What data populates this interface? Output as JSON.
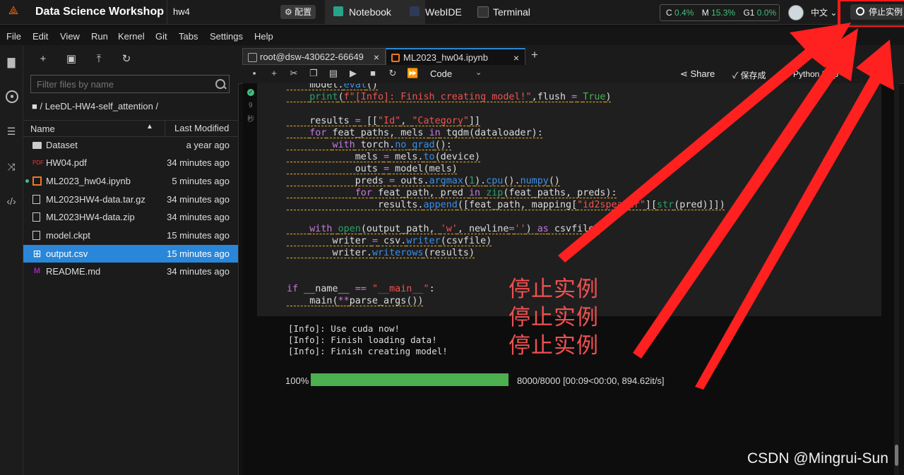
{
  "topbar": {
    "brand": "Data Science Workshop",
    "project": "hw4",
    "config_label": "⚙ 配置",
    "tabs": [
      {
        "label": "Notebook"
      },
      {
        "label": "WebIDE"
      },
      {
        "label": "Terminal"
      }
    ],
    "metrics": {
      "c_label": "C",
      "c_value": "0.4%",
      "m_label": "M",
      "m_value": "15.3%",
      "g_label": "G1",
      "g_value": "0.0%"
    },
    "language": "中文 ⌄",
    "stop_label": "停止实例"
  },
  "menu": [
    "File",
    "Edit",
    "View",
    "Run",
    "Kernel",
    "Git",
    "Tabs",
    "Settings",
    "Help"
  ],
  "filebrowser": {
    "filter_placeholder": "Filter files by name",
    "breadcrumb": "■ / LeeDL-HW4-self_attention /",
    "col_name": "Name",
    "col_modified": "Last Modified",
    "files": [
      {
        "name": "Dataset",
        "modified": "a year ago"
      },
      {
        "name": "HW04.pdf",
        "modified": "34 minutes ago"
      },
      {
        "name": "ML2023_hw04.ipynb",
        "modified": "5 minutes ago"
      },
      {
        "name": "ML2023HW4-data.tar.gz",
        "modified": "34 minutes ago"
      },
      {
        "name": "ML2023HW4-data.zip",
        "modified": "34 minutes ago"
      },
      {
        "name": "model.ckpt",
        "modified": "15 minutes ago"
      },
      {
        "name": "output.csv",
        "modified": "15 minutes ago"
      },
      {
        "name": "README.md",
        "modified": "34 minutes ago"
      }
    ]
  },
  "doc_tabs": [
    {
      "label": "root@dsw-430622-66649"
    },
    {
      "label": "ML2023_hw04.ipynb"
    }
  ],
  "nbtoolbar": {
    "cell_type": "Code",
    "share": "Share",
    "save": "保存成",
    "kernel": "Python 3 (ip"
  },
  "cell": {
    "gutter_num": "9",
    "gutter_unit": "秒"
  },
  "output": {
    "lines": "[Info]: Use cuda now!\n[Info]: Finish loading data!\n[Info]: Finish creating model!",
    "progress_pct_label": "100%",
    "progress_fraction": 1.0,
    "progress_info": "8000/8000  [00:09<00:00,  894.62it/s]"
  },
  "annotation": {
    "red_text": [
      "停止实例",
      "停止实例",
      "停止实例"
    ],
    "watermark": "CSDN @Mingrui-Sun"
  }
}
